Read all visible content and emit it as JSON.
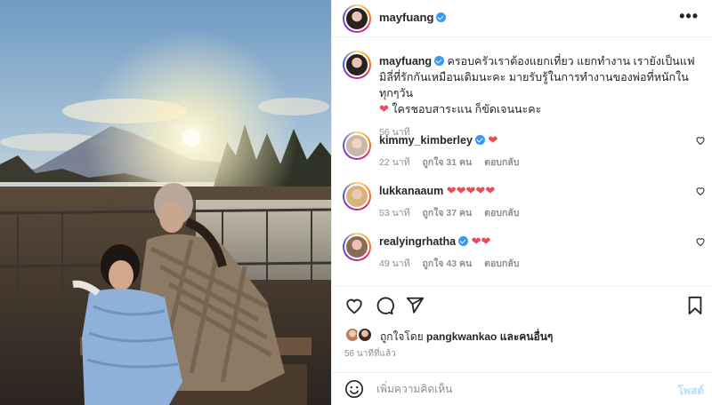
{
  "post": {
    "author": "mayfuang",
    "caption": "ครอบครัวเราต้องแยกเที่ยว แยกทำงาน เรายังเป็นแฟมิลี่ที่รักกันเหมือนเดิมนะคะ มายรับรู้ในการทำงานของพ่อที่หนักในทุกๆวัน",
    "caption_tail": " ใครชอบสาระแน ก็ขัดเจนนะคะ",
    "caption_time": "56 นาที"
  },
  "comments": [
    {
      "user": "kimmy_kimberley",
      "hearts": "❤",
      "time": "22 นาที",
      "likes": "ถูกใจ 31 คน",
      "reply": "ตอบกลับ"
    },
    {
      "user": "lukkanaaum",
      "hearts": "❤❤❤❤❤",
      "time": "53 นาที",
      "likes": "ถูกใจ 37 คน",
      "reply": "ตอบกลับ"
    },
    {
      "user": "realyingrhatha",
      "hearts": "❤❤",
      "time": "49 นาที",
      "likes": "ถูกใจ 43 คน",
      "reply": "ตอบกลับ"
    }
  ],
  "liked_by": {
    "prefix": "ถูกใจโดย ",
    "user": "pangkwankao",
    "suffix": " และคนอื่นๆ"
  },
  "posted_ago": "56 นาทีที่แล้ว",
  "composer": {
    "placeholder": "เพิ่มความคิดเห็น",
    "post_label": "โพสต์"
  },
  "icons": {
    "more": "more-dots-icon",
    "like": "heart-outline-icon",
    "comment": "comment-bubble-icon",
    "share": "paper-plane-icon",
    "save": "bookmark-icon",
    "emoji": "emoji-smile-icon"
  },
  "colors": {
    "verified": "#3897f0",
    "heart": "#ed4956",
    "post_disabled": "#b2dffc"
  }
}
